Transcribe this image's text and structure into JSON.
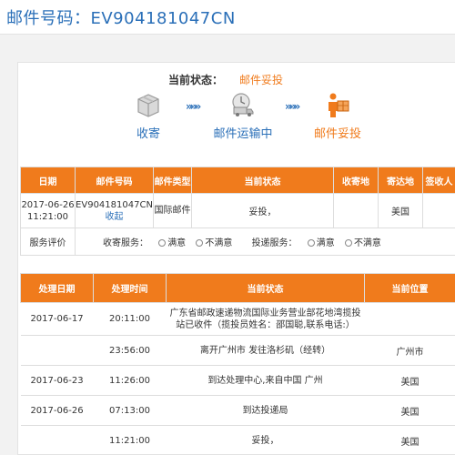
{
  "header": {
    "title": "邮件号码：EV904181047CN"
  },
  "status": {
    "label": "当前状态：",
    "value": "邮件妥投"
  },
  "steps": [
    {
      "label": "收寄",
      "icon": "box-icon"
    },
    {
      "label": "邮件运输中",
      "icon": "delivery-truck-icon"
    },
    {
      "label": "邮件妥投",
      "icon": "courier-person-icon"
    }
  ],
  "arrows": {
    "symbol": "»»»"
  },
  "summary_table": {
    "headers": [
      "日期",
      "邮件号码",
      "邮件类型",
      "当前状态",
      "收寄地",
      "寄达地",
      "签收人"
    ],
    "row": {
      "date": "2017-06-26 11:21:00",
      "number": "EV904181047CN",
      "collapse": "收起",
      "type": "国际邮件",
      "status": "妥投，",
      "origin": "",
      "destination": "美国",
      "signer": ""
    },
    "evaluation": {
      "label": "服务评价",
      "collect_label": "收寄服务：",
      "deliver_label": "投递服务：",
      "option_satisfied": "满意",
      "option_unsatisfied": "不满意"
    }
  },
  "history_table": {
    "headers": [
      "处理日期",
      "处理时间",
      "当前状态",
      "当前位置"
    ],
    "rows": [
      {
        "date": "2017-06-17",
        "time": "20:11:00",
        "status": "广东省邮政速递物流国际业务营业部花地湾揽投站已收件（揽投员姓名：邵国聪,联系电话:）",
        "location": ""
      },
      {
        "date": "",
        "time": "23:56:00",
        "status": "离开广州市 发往洛杉矶（经转）",
        "location": "广州市"
      },
      {
        "date": "2017-06-23",
        "time": "11:26:00",
        "status": "到达处理中心,来自中国 广州",
        "location": "美国"
      },
      {
        "date": "2017-06-26",
        "time": "07:13:00",
        "status": "到达投递局",
        "location": "美国"
      },
      {
        "date": "",
        "time": "11:21:00",
        "status": "妥投，",
        "location": "美国"
      }
    ]
  },
  "colors": {
    "accent": "#f07b1c",
    "link": "#2a6fb8"
  }
}
